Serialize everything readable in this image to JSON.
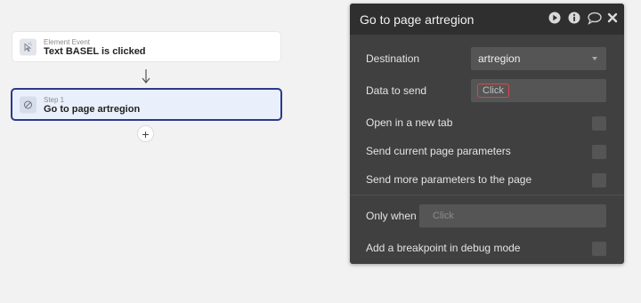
{
  "workflow": {
    "event": {
      "sub": "Element Event",
      "title": "Text BASEL is clicked",
      "icon": "cursor-click-icon"
    },
    "step": {
      "sub": "Step 1",
      "title": "Go to page artregion",
      "icon": "navigate-icon"
    },
    "add_step_label": "+"
  },
  "panel": {
    "title": "Go to page artregion",
    "header_icons": [
      "play-icon",
      "info-icon",
      "comment-icon",
      "close-icon"
    ],
    "destination": {
      "label": "Destination",
      "value": "artregion"
    },
    "data_to_send": {
      "label": "Data to send",
      "value": "Click"
    },
    "open_new_tab": {
      "label": "Open in a new tab"
    },
    "send_current": {
      "label": "Send current page parameters"
    },
    "send_more": {
      "label": "Send more parameters to the page"
    },
    "only_when": {
      "label": "Only when",
      "placeholder": "Click"
    },
    "breakpoint": {
      "label": "Add a breakpoint in debug mode"
    }
  },
  "colors": {
    "panel_bg": "#404040",
    "header_bg": "#2f2f2f",
    "step_border": "#2b3a8c",
    "token_border": "#e0434b"
  }
}
